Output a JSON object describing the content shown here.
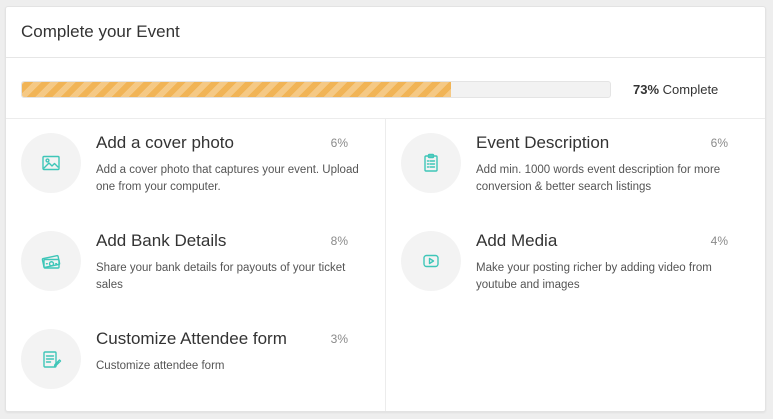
{
  "header": {
    "title": "Complete your Event"
  },
  "progress": {
    "fraction": 0.73,
    "percent_text": "73%",
    "suffix_text": " Complete",
    "color": "#f1b456"
  },
  "accent_color": "#3ec6b8",
  "tasks": [
    {
      "title": "Add a cover photo",
      "percent": "6%",
      "description": "Add a cover photo that captures your event. Upload one from your computer.",
      "icon": "image-icon"
    },
    {
      "title": "Event Description",
      "percent": "6%",
      "description": "Add min. 1000 words event description for more conversion & better search listings",
      "icon": "clipboard-list-icon"
    },
    {
      "title": "Add Bank Details",
      "percent": "8%",
      "description": "Share your bank details for payouts of your ticket sales",
      "icon": "money-icon"
    },
    {
      "title": "Add Media",
      "percent": "4%",
      "description": "Make your posting richer by adding video from youtube and images",
      "icon": "play-video-icon"
    },
    {
      "title": "Customize Attendee form",
      "percent": "3%",
      "description": "Customize attendee form",
      "icon": "edit-form-icon"
    }
  ]
}
